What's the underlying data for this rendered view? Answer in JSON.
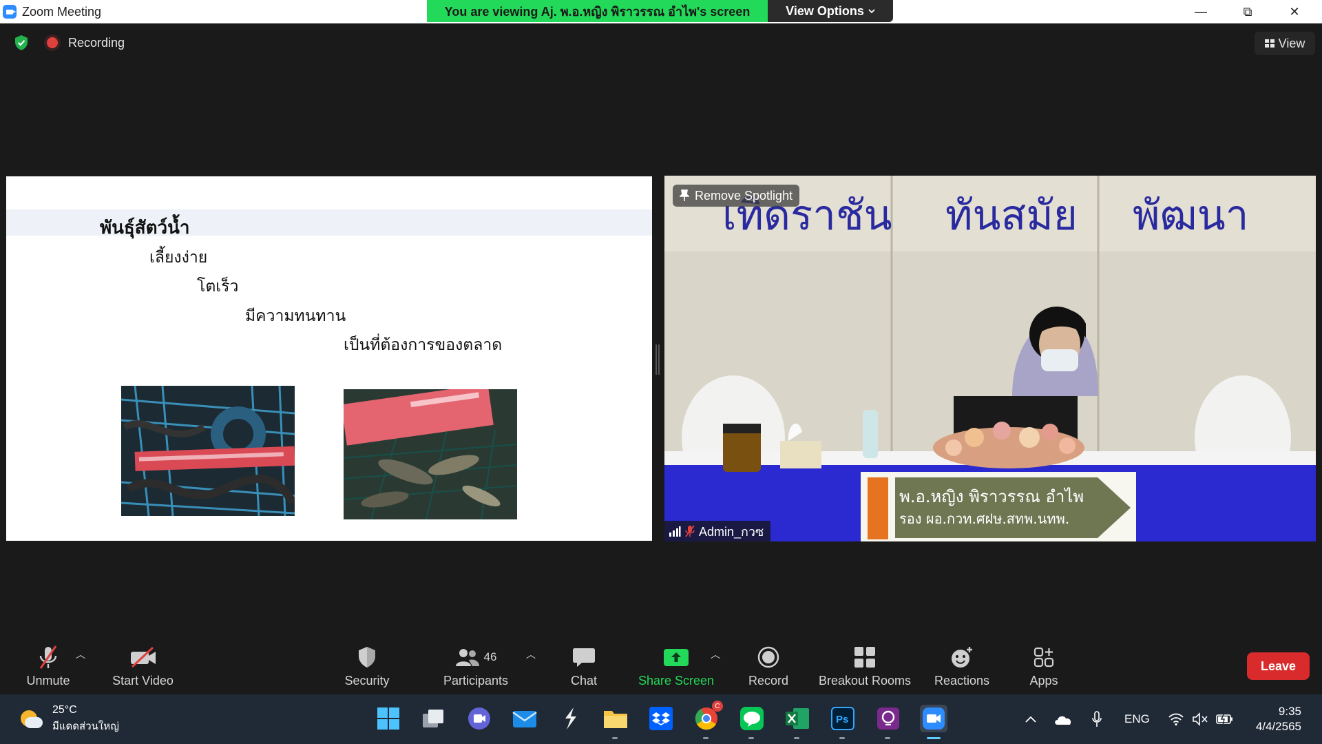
{
  "window": {
    "title": "Zoom Meeting",
    "viewing_banner": "You are viewing Aj. พ.อ.หญิง พิราวรรณ  อำไพ's screen",
    "view_options_label": "View Options",
    "minimize_glyph": "—",
    "restore_glyph": "⧉",
    "close_glyph": "✕"
  },
  "status": {
    "recording_label": "Recording",
    "view_label": "View"
  },
  "slide": {
    "title": "พันธุ์สัตว์น้ำ",
    "lines": [
      "เลี้ยงง่าย",
      "โตเร็ว",
      "มีความทนทาน",
      "เป็นที่ต้องการของตลาด"
    ],
    "photo1_desc": "eels in blue basket with red ruler",
    "photo2_desc": "fish in net with red ruler"
  },
  "camera": {
    "remove_spotlight_label": "Remove Spotlight",
    "participant_name": "Admin_กวซ",
    "banner_words": [
      "เทิดราชัน",
      "ทันสมัย",
      "พัฒนา"
    ],
    "lower_third_line1": "พ.อ.หญิง พิราวรรณ  อำไพ",
    "lower_third_line2": "รอง ผอ.กวท.ศฝษ.สทพ.นทพ."
  },
  "toolbar": {
    "unmute": "Unmute",
    "start_video": "Start Video",
    "security": "Security",
    "participants": "Participants",
    "participants_count": "46",
    "chat": "Chat",
    "share_screen": "Share Screen",
    "record": "Record",
    "breakout_rooms": "Breakout Rooms",
    "reactions": "Reactions",
    "apps": "Apps",
    "leave": "Leave"
  },
  "taskbar": {
    "temperature": "25°C",
    "weather_desc": "มีแดดส่วนใหญ่",
    "language": "ENG",
    "time": "9:35",
    "date": "4/4/2565",
    "chrome_badge": "C",
    "apps": [
      "start-icon",
      "task-view-icon",
      "teams-icon",
      "mail-icon",
      "app-s-icon",
      "file-explorer-icon",
      "dropbox-icon",
      "chrome-icon",
      "line-icon",
      "excel-icon",
      "photoshop-icon",
      "pdf-icon",
      "zoom-icon"
    ]
  },
  "colors": {
    "banner_green": "#23d959",
    "share_green": "#23d959",
    "leave_red": "#d92b2b",
    "zoom_blue": "#2d8cff",
    "camera_text_blue": "#2a2aa0"
  }
}
